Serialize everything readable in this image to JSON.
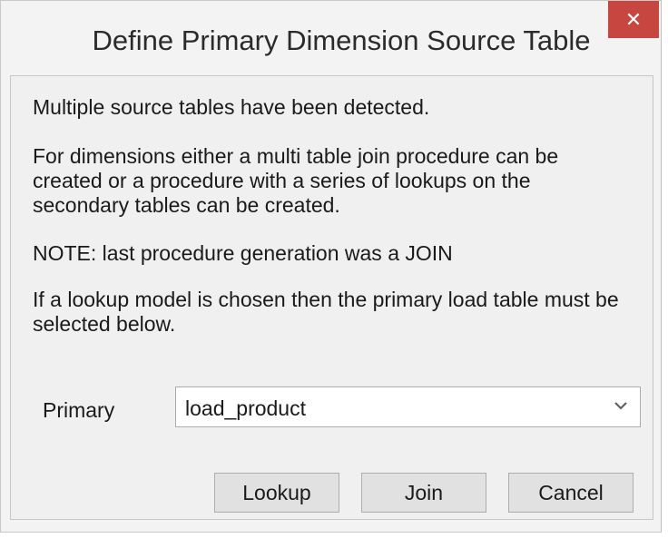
{
  "dialog": {
    "title": "Define Primary Dimension Source Table",
    "close_glyph": "✕"
  },
  "message": {
    "line1": "Multiple source tables have been detected.",
    "line2": "For dimensions either a multi table join procedure can be created or a procedure with a series of lookups on the secondary tables can be created.",
    "line3": "NOTE: last procedure generation was a JOIN",
    "line4": "If a lookup model is chosen then the primary load table must be selected below."
  },
  "primary": {
    "label": "Primary",
    "selected": "load_product"
  },
  "buttons": {
    "lookup": "Lookup",
    "join": "Join",
    "cancel": "Cancel"
  },
  "colors": {
    "close_bg": "#c7463f",
    "dialog_bg": "#f0f0f0",
    "button_bg": "#e1e1e1"
  }
}
